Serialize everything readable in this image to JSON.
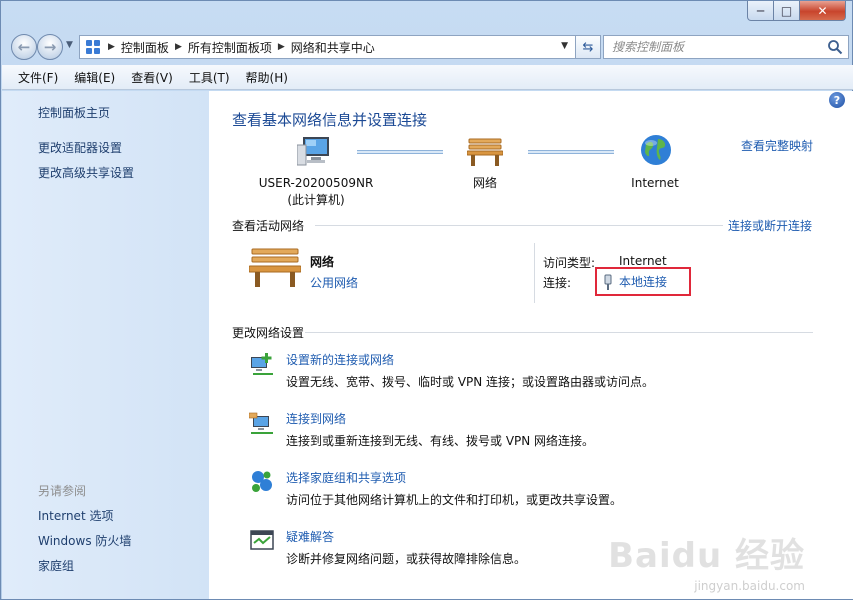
{
  "window": {
    "caption": {
      "minimize": "─",
      "maximize": "□",
      "close": "✕"
    }
  },
  "address": {
    "breadcrumbs": [
      "控制面板",
      "所有控制面板项",
      "网络和共享中心"
    ],
    "search_placeholder": "搜索控制面板"
  },
  "menu": [
    "文件(F)",
    "编辑(E)",
    "查看(V)",
    "工具(T)",
    "帮助(H)"
  ],
  "sidebar": {
    "links": [
      "控制面板主页",
      "更改适配器设置",
      "更改高级共享设置"
    ],
    "see_also_heading": "另请参阅",
    "see_also": [
      "Internet 选项",
      "Windows 防火墙",
      "家庭组"
    ]
  },
  "main": {
    "title": "查看基本网络信息并设置连接",
    "full_map_link": "查看完整映射",
    "nodes": {
      "computer_name": "USER-20200509NR",
      "computer_sub": "(此计算机)",
      "network": "网络",
      "internet": "Internet"
    },
    "active": {
      "heading": "查看活动网络",
      "connect_link": "连接或断开连接",
      "network_name": "网络",
      "network_type": "公用网络",
      "access_label": "访问类型:",
      "access_value": "Internet",
      "connection_label": "连接:",
      "connection_value": "本地连接"
    },
    "change": {
      "heading": "更改网络设置",
      "tasks": [
        {
          "title": "设置新的连接或网络",
          "desc": "设置无线、宽带、拨号、临时或 VPN 连接；或设置路由器或访问点。"
        },
        {
          "title": "连接到网络",
          "desc": "连接到或重新连接到无线、有线、拨号或 VPN 网络连接。"
        },
        {
          "title": "选择家庭组和共享选项",
          "desc": "访问位于其他网络计算机上的文件和打印机，或更改共享设置。"
        },
        {
          "title": "疑难解答",
          "desc": "诊断并修复网络问题，或获得故障排除信息。"
        }
      ]
    }
  },
  "watermark": {
    "brand": "Baidu 经验",
    "url": "jingyan.baidu.com"
  },
  "colors": {
    "link": "#1f5cb0",
    "title": "#1c4a95",
    "highlight_box": "#e0283a",
    "sidebar_bg": "#d8e6f7"
  }
}
